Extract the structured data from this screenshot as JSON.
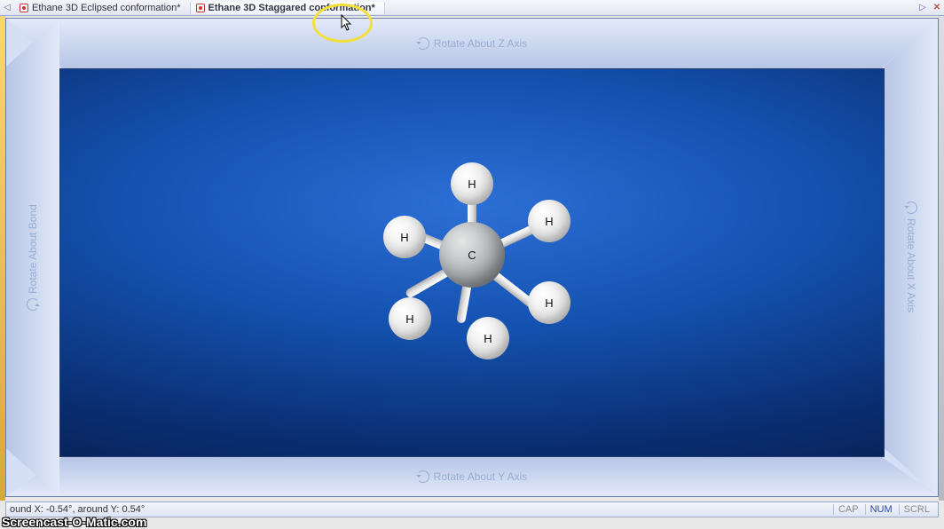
{
  "tabs": {
    "items": [
      {
        "label": "Ethane 3D Eclipsed conformation*"
      },
      {
        "label": "Ethane 3D Staggared conformation*"
      }
    ],
    "active_index": 1
  },
  "viewport": {
    "rotate_z": "Rotate About Z Axis",
    "rotate_y": "Rotate About Y Axis",
    "rotate_x": "Rotate About X Axis",
    "rotate_bond": "Rotate About Bond"
  },
  "molecule": {
    "center_label": "C",
    "hydrogens": [
      "H",
      "H",
      "H",
      "H",
      "H",
      "H"
    ]
  },
  "status": {
    "left": "ound X: -0.54°, around Y: 0.54°",
    "cap": "CAP",
    "num": "NUM",
    "scrl": "SCRL"
  },
  "watermark": "Screencast-O-Matic.com"
}
